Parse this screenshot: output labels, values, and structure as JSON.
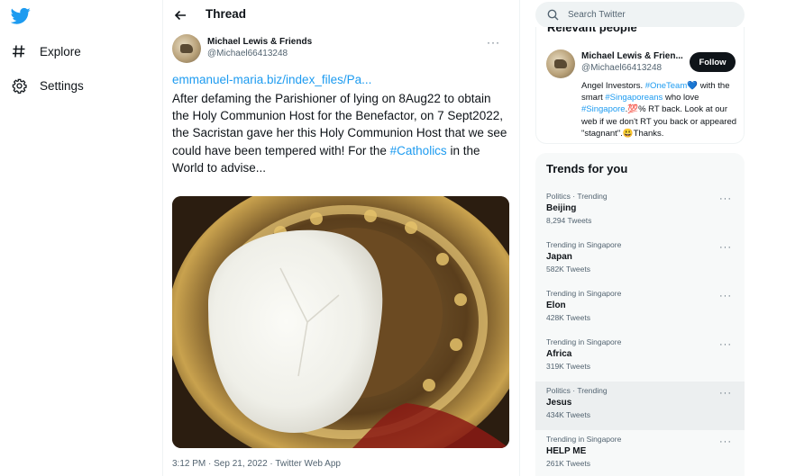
{
  "nav": {
    "logo_icon": "twitter-bird-icon",
    "items": [
      {
        "label": "Explore",
        "icon": "hashtag-icon"
      },
      {
        "label": "Settings",
        "icon": "gear-icon"
      }
    ]
  },
  "header": {
    "title": "Thread",
    "back_icon": "back-arrow-icon"
  },
  "tweet": {
    "author_name": "Michael Lewis & Friends",
    "author_handle": "@Michael66413248",
    "more": "···",
    "link": "emmanuel-maria.biz/index_files/Pa...",
    "text_before": "After defaming the Parishioner of lying on 8Aug22 to obtain the Holy Communion Host for the Benefactor, on 7 Sept2022, the Sacristan gave her this Holy Communion Host that we see could have been tempered with! For the ",
    "hashtag": "#Catholics",
    "text_after": " in the World to advise...",
    "meta": "3:12 PM · Sep 21, 2022 · Twitter Web App"
  },
  "search": {
    "placeholder": "Search Twitter",
    "icon": "search-icon"
  },
  "relevant": {
    "title": "Relevant people",
    "name": "Michael Lewis & Frien...",
    "handle": "@Michael66413248",
    "follow_label": "Follow",
    "bio_1": "Angel Investors. ",
    "bio_tag1": "#OneTeam",
    "bio_heart": "💙",
    "bio_2": " with the smart ",
    "bio_tag2": "#Singaporeans",
    "bio_3": " who love ",
    "bio_tag3": "#Singapore",
    "bio_4": ".💯% RT back. Look at our web if we don't RT you back or appeared \"stagnant\".😃Thanks."
  },
  "trends": {
    "title": "Trends for you",
    "items": [
      {
        "context": "Politics · Trending",
        "name": "Beijing",
        "count": "8,294 Tweets"
      },
      {
        "context": "Trending in Singapore",
        "name": "Japan",
        "count": "582K Tweets"
      },
      {
        "context": "Trending in Singapore",
        "name": "Elon",
        "count": "428K Tweets"
      },
      {
        "context": "Trending in Singapore",
        "name": "Africa",
        "count": "319K Tweets"
      },
      {
        "context": "Politics · Trending",
        "name": "Jesus",
        "count": "434K Tweets"
      },
      {
        "context": "Trending in Singapore",
        "name": "HELP ME",
        "count": "261K Tweets"
      }
    ],
    "more": "···"
  },
  "colors": {
    "accent": "#1d9bf0",
    "text": "#0f1419",
    "muted": "#536471",
    "panel": "#f7f9f9"
  }
}
